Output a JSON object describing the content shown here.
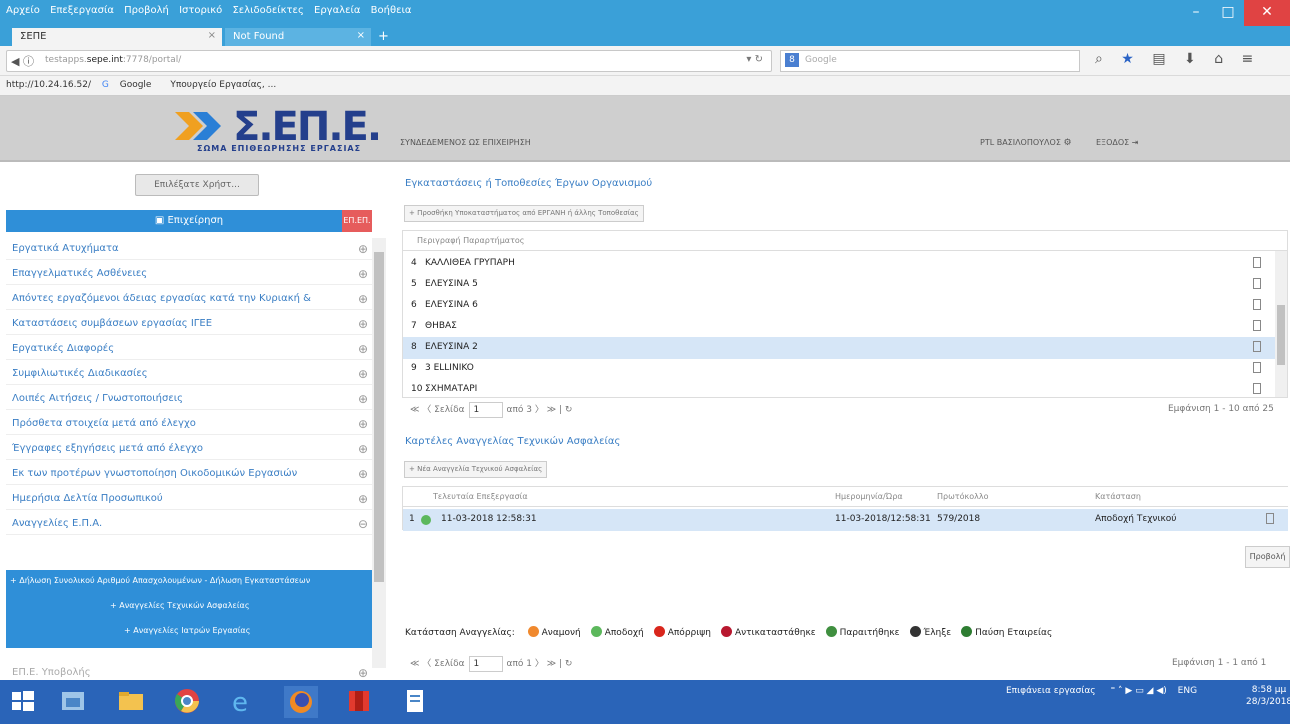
{
  "browser": {
    "menu": [
      "Αρχείο",
      "Επεξεργασία",
      "Προβολή",
      "Ιστορικό",
      "Σελιδοδείκτες",
      "Εργαλεία",
      "Βοήθεια"
    ],
    "tabs": [
      {
        "label": "ΣΕΠΕ",
        "active": true
      },
      {
        "label": "Not Found",
        "active": false
      }
    ],
    "url_prefix": "testapps.",
    "url_host": "sepe.int",
    "url_suffix": ":7778/portal/",
    "search_placeholder": "Google",
    "bookmarks": [
      "http://10.24.16.52/",
      "Google",
      "Υπουργείο Εργασίας, ..."
    ]
  },
  "app": {
    "logo_text": "Σ.ΕΠ.Ε.",
    "logo_sub": "ΣΩΜΑ ΕΠΙΘΕΩΡΗΣΗΣ ΕΡΓΑΣΙΑΣ",
    "header_section": "ΣΥΝΔΕΔΕΜΕΝΟΣ ΩΣ ΕΠΙΧΕΙΡΗΣΗ",
    "user": "ΡΤL ΒΑΣΙΛΟΠΟΥΛΟΣ",
    "logout": "ΕΞΟΔΟΣ"
  },
  "sidebar": {
    "choose_button": "Επιλέξατε Χρήστ...",
    "header": "Επιχείρηση",
    "header_badge": "ΕΠ.ΕΠ.",
    "items": [
      "Εργατικά Ατυχήματα",
      "Επαγγελματικές Ασθένειες",
      "Απόντες εργαζόμενοι άδειας εργασίας κατά την Κυριακή &",
      "Καταστάσεις συμβάσεων εργασίας ΙΓΕΕ",
      "Εργατικές Διαφορές",
      "Συμφιλιωτικές Διαδικασίες",
      "Λοιπές Αιτήσεις / Γνωστοποιήσεις",
      "Πρόσθετα στοιχεία μετά από έλεγχο",
      "Έγγραφες εξηγήσεις μετά από έλεγχο",
      "Εκ των προτέρων γνωστοποίηση Οικοδομικών Εργασιών",
      "Ημερήσια Δελτία Προσωπικού",
      "Αναγγελίες Ε.Π.Α."
    ],
    "sub_items": [
      "Δήλωση Συνολικού Αριθμού Απασχολουμένων - Δήλωση Εγκαταστάσεων",
      "Αναγγελίες Τεχνικών Ασφαλείας",
      "Αναγγελίες Ιατρών Εργασίας"
    ],
    "last_item": "ΕΠ.Ε. Υποβολής"
  },
  "installations": {
    "title": "Εγκαταστάσεις ή Τοποθεσίες Έργων Οργανισμού",
    "add_button": "Προσθήκη Υποκαταστήματος από ΕΡΓΑΝΗ ή άλλης Τοποθεσίας",
    "column": "Περιγραφή Παραρτήματος",
    "rows": [
      {
        "num": "4",
        "name": "ΚΑΛΛΙΘΕΑ ΓΡΥΠΑΡΗ"
      },
      {
        "num": "5",
        "name": "ΕΛΕΥΣΙΝΑ 5"
      },
      {
        "num": "6",
        "name": "ΕΛΕΥΣΙΝΑ 6"
      },
      {
        "num": "7",
        "name": "ΘΗΒΑΣ"
      },
      {
        "num": "8",
        "name": "ΕΛΕΥΣΙΝΑ 2"
      },
      {
        "num": "9",
        "name": "3 ELLINIKO"
      },
      {
        "num": "10",
        "name": "ΣΧΗΜΑΤΑΡΙ"
      }
    ],
    "selected_index": 4,
    "pager": {
      "page_label": "Σελίδα",
      "page": "1",
      "of": "από 3",
      "summary": "Εμφάνιση 1 - 10 από 25"
    }
  },
  "announcements": {
    "title": "Καρτέλες Αναγγελίας Τεχνικών Ασφαλείας",
    "add_button": "Νέα Αναγγελία Τεχνικού Ασφαλείας",
    "columns": [
      "Τελευταία Επεξεργασία",
      "Ημερομηνία/Ώρα",
      "Πρωτόκολλο",
      "Κατάσταση"
    ],
    "rows": [
      {
        "num": "1",
        "edited": "11-03-2018 12:58:31",
        "datetime": "11-03-2018/12:58:31",
        "protocol": "579/2018",
        "status": "Αποδοχή Τεχνικού"
      }
    ],
    "view_button": "Προβολή",
    "legend_label": "Κατάσταση Αναγγελίας:",
    "legend": [
      {
        "label": "Αναμονή",
        "color": "#f0892e"
      },
      {
        "label": "Αποδοχή",
        "color": "#5cb85c"
      },
      {
        "label": "Απόρριψη",
        "color": "#d9261c"
      },
      {
        "label": "Αντικαταστάθηκε",
        "color": "#b8182f"
      },
      {
        "label": "Παραιτήθηκε",
        "color": "#3f8f3f"
      },
      {
        "label": "Έληξε",
        "color": "#333333"
      },
      {
        "label": "Παύση Εταιρείας",
        "color": "#2e7d32"
      }
    ],
    "pager": {
      "page_label": "Σελίδα",
      "page": "1",
      "of": "από 1",
      "summary": "Εμφάνιση 1 - 1 από 1"
    }
  },
  "taskbar": {
    "tray_text": "Επιφάνεια εργασίας",
    "lang": "ENG",
    "time": "8:58 μμ",
    "date": "28/3/2018"
  }
}
